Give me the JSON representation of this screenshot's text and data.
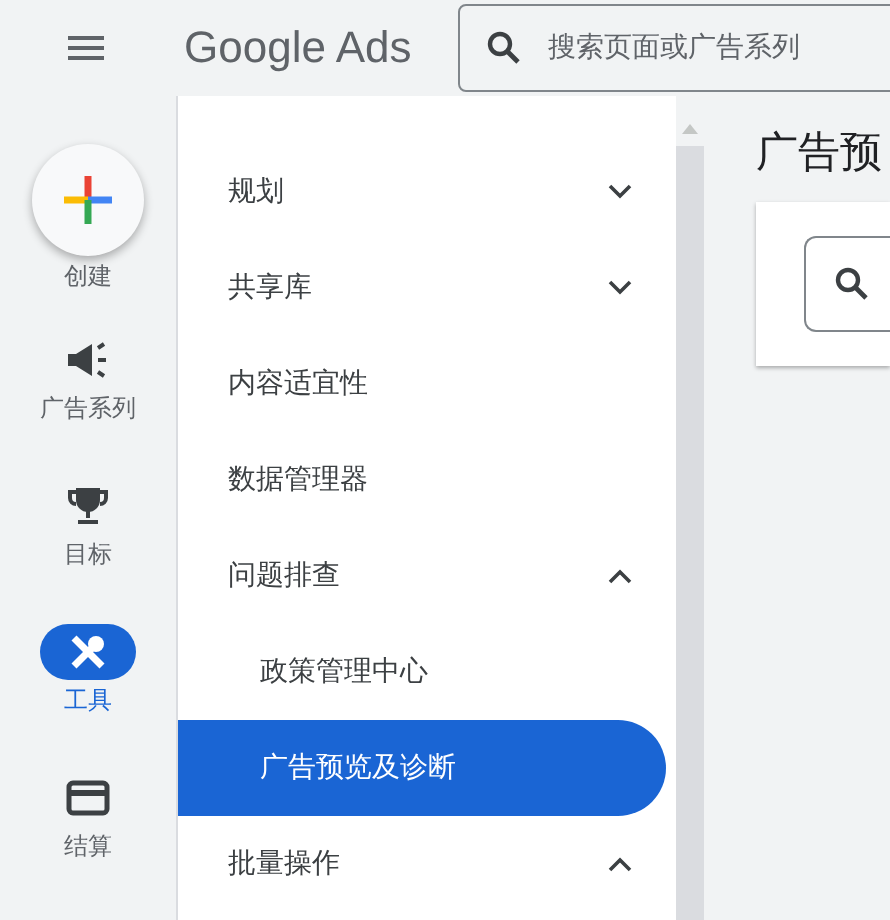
{
  "header": {
    "product": "Google Ads",
    "search": {
      "placeholder": "搜索页面或广告系列"
    }
  },
  "rail": [
    {
      "kind": "create",
      "label": "创建",
      "selected": false
    },
    {
      "kind": "campaigns",
      "label": "广告系列",
      "selected": false
    },
    {
      "kind": "goals",
      "label": "目标",
      "selected": false
    },
    {
      "kind": "tools",
      "label": "工具",
      "selected": true
    },
    {
      "kind": "billing",
      "label": "结算",
      "selected": false
    }
  ],
  "menu": [
    {
      "label": "规划",
      "expanded": false,
      "selected": false
    },
    {
      "label": "共享库",
      "expanded": false,
      "selected": false
    },
    {
      "label": "内容适宜性",
      "selected": false
    },
    {
      "label": "数据管理器",
      "selected": false
    },
    {
      "label": "问题排查",
      "expanded": true,
      "selected": false,
      "children": [
        {
          "label": "政策管理中心",
          "selected": false
        },
        {
          "label": "广告预览及诊断",
          "selected": true
        }
      ]
    },
    {
      "label": "批量操作",
      "expanded": true,
      "selected": false
    }
  ],
  "content": {
    "title": "广告预"
  }
}
